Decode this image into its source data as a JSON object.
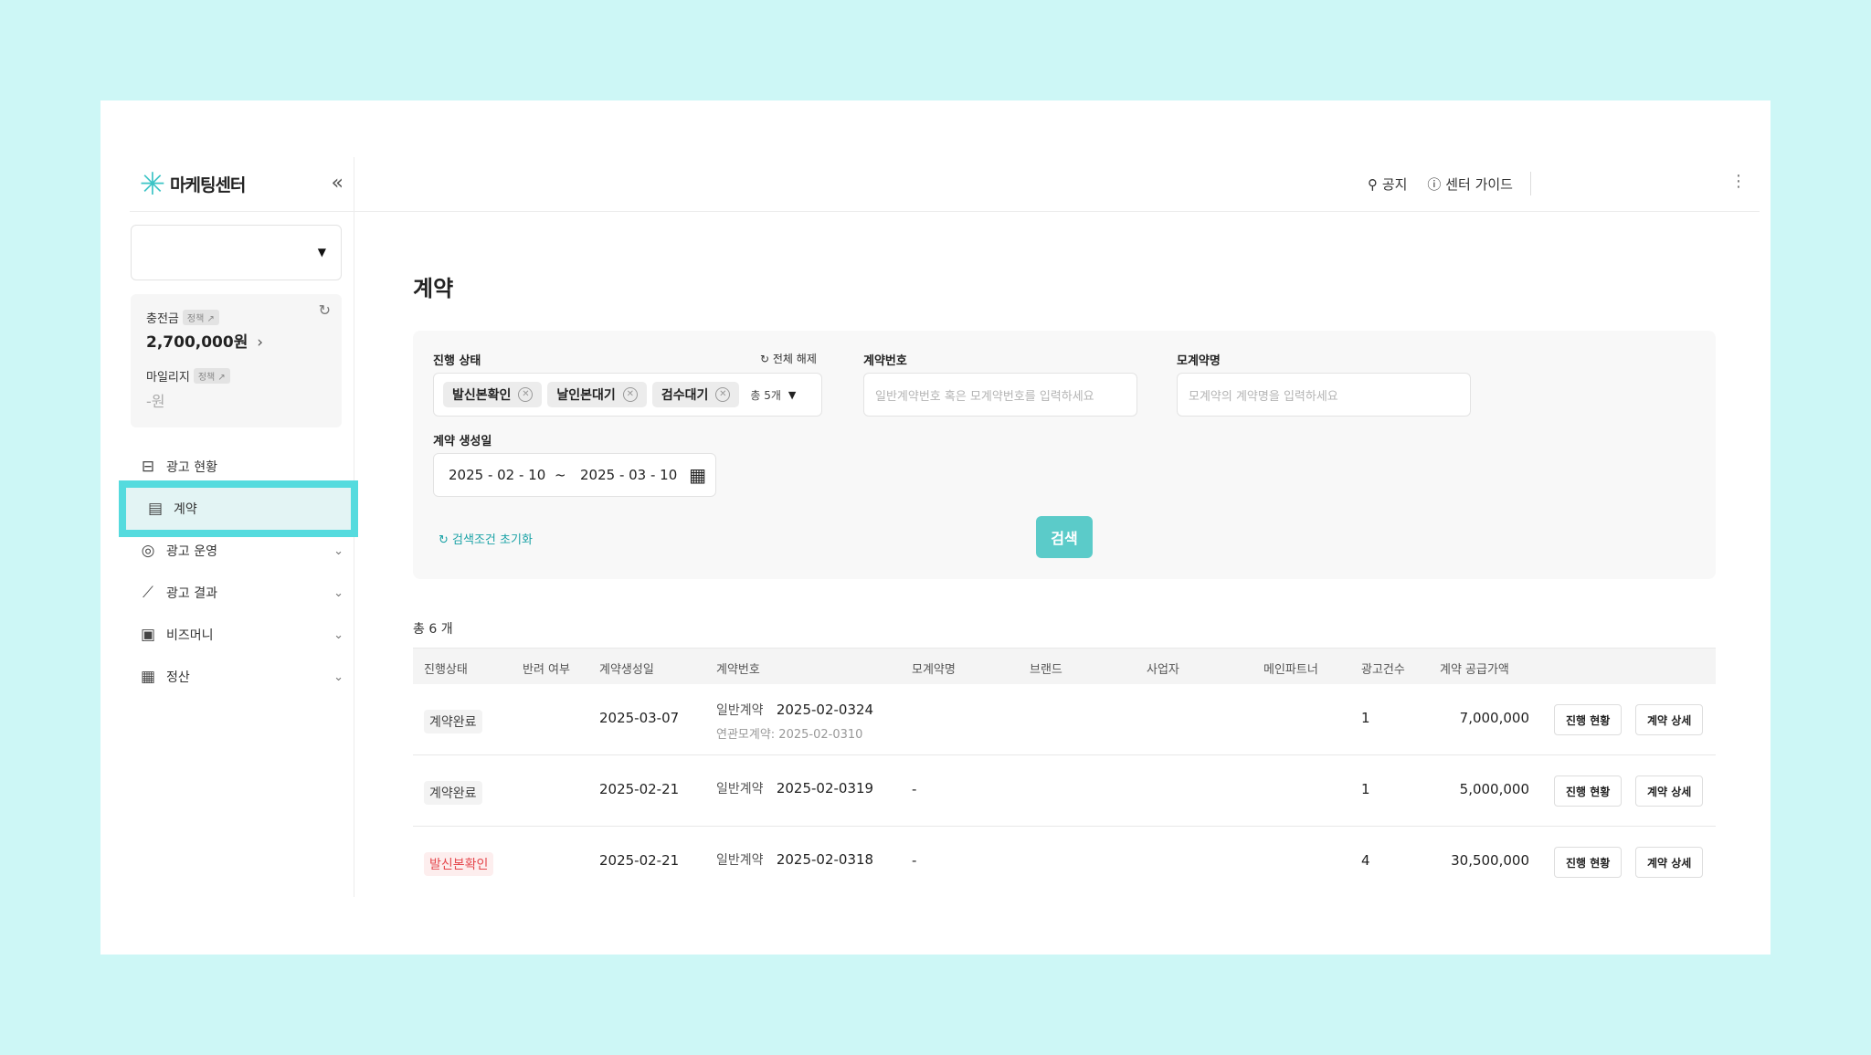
{
  "app": {
    "logo_text": "마케팅센터",
    "collapse_icon": "chevrons-left-icon"
  },
  "header": {
    "notice_label": "공지",
    "guide_label": "센터 가이드"
  },
  "sidebar": {
    "account_select_value": "",
    "balance": {
      "charge_label": "충전금",
      "charge_tag": "정책 ↗",
      "charge_value": "2,700,000원",
      "mileage_label": "마일리지",
      "mileage_tag": "정책 ↗",
      "mileage_value": "-원"
    },
    "items": [
      {
        "label": "광고 현황",
        "icon": "ad-status-icon",
        "expandable": false,
        "active": false
      },
      {
        "label": "계약",
        "icon": "contract-icon",
        "expandable": false,
        "active": true
      },
      {
        "label": "광고 운영",
        "icon": "target-icon",
        "expandable": true,
        "active": false
      },
      {
        "label": "광고 결과",
        "icon": "chart-line-icon",
        "expandable": true,
        "active": false
      },
      {
        "label": "비즈머니",
        "icon": "wallet-icon",
        "expandable": true,
        "active": false
      },
      {
        "label": "정산",
        "icon": "receipt-icon",
        "expandable": true,
        "active": false
      }
    ]
  },
  "main": {
    "title": "계약",
    "filter": {
      "status_label": "진행 상태",
      "reset_all_label": "전체 해제",
      "chips": [
        "발신본확인",
        "날인본대기",
        "검수대기"
      ],
      "chip_count": "총 5개",
      "contract_no_label": "계약번호",
      "contract_no_placeholder": "일반계약번호 혹은 모계약번호를 입력하세요",
      "parent_name_label": "모계약명",
      "parent_name_placeholder": "모계약의 계약명을 입력하세요",
      "date_label": "계약 생성일",
      "date_from": "2025 - 02 - 10",
      "date_sep": "~",
      "date_to": "2025 - 03 - 10",
      "reset_cond_label": "검색조건 초기화",
      "search_label": "검색"
    },
    "total_label": "총 6 개",
    "table": {
      "headers": [
        "진행상태",
        "반려 여부",
        "계약생성일",
        "계약번호",
        "모계약명",
        "브랜드",
        "사업자",
        "메인파트너",
        "광고건수",
        "계약 공급가액"
      ],
      "rows": [
        {
          "status": "계약완료",
          "status_color": "gray",
          "created": "2025-03-07",
          "type": "일반계약",
          "number": "2025-02-0324",
          "linked": "연관모계약: 2025-02-0310",
          "parent": "",
          "count": "1",
          "amount": "7,000,000"
        },
        {
          "status": "계약완료",
          "status_color": "gray",
          "created": "2025-02-21",
          "type": "일반계약",
          "number": "2025-02-0319",
          "linked": "",
          "parent": "-",
          "count": "1",
          "amount": "5,000,000"
        },
        {
          "status": "발신본확인",
          "status_color": "red",
          "created": "2025-02-21",
          "type": "일반계약",
          "number": "2025-02-0318",
          "linked": "",
          "parent": "-",
          "count": "4",
          "amount": "30,500,000"
        }
      ],
      "progress_btn": "진행 현황",
      "detail_btn": "계약 상세"
    }
  }
}
